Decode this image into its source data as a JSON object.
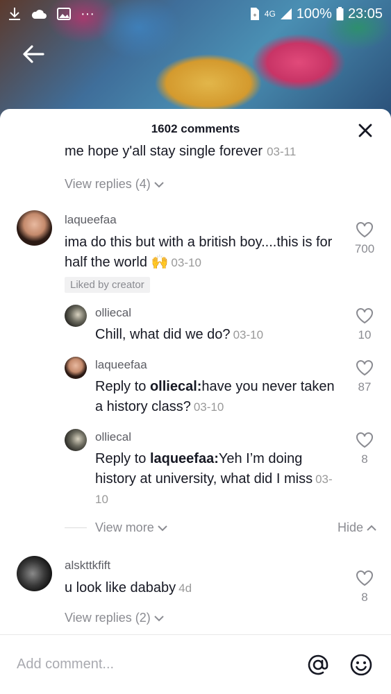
{
  "status_bar": {
    "dots": "···",
    "network": "4G",
    "battery": "100%",
    "time": "23:05"
  },
  "header": {
    "comments_count": "1602 comments"
  },
  "top_partial": {
    "text": "me hope y'all stay single forever",
    "time": "03-11",
    "view_replies": "View replies (4)"
  },
  "comments": [
    {
      "username": "laqueefaa",
      "text": "ima do this but with a british boy....this is for half the world 🙌",
      "time": "03-10",
      "likes": "700",
      "badge": "Liked by creator"
    },
    {
      "username": "alskttkfift",
      "text": "u look like dababy",
      "time": "4d",
      "likes": "8",
      "view_replies": "View replies (2)"
    }
  ],
  "replies": [
    {
      "username": "olliecal",
      "text": "Chill, what did we do?",
      "time": "03-10",
      "likes": "10"
    },
    {
      "username": "laqueefaa",
      "prefix": "Reply to ",
      "mention": "olliecal:",
      "text": "have you never taken a history class?",
      "time": "03-10",
      "likes": "87"
    },
    {
      "username": "olliecal",
      "prefix": "Reply to ",
      "mention": "laqueefaa:",
      "text": "Yeh I’m doing history at university, what did I miss",
      "time": "03-10",
      "likes": "8"
    }
  ],
  "thread_controls": {
    "view_more": "View more",
    "hide": "Hide"
  },
  "input": {
    "placeholder": "Add comment..."
  }
}
